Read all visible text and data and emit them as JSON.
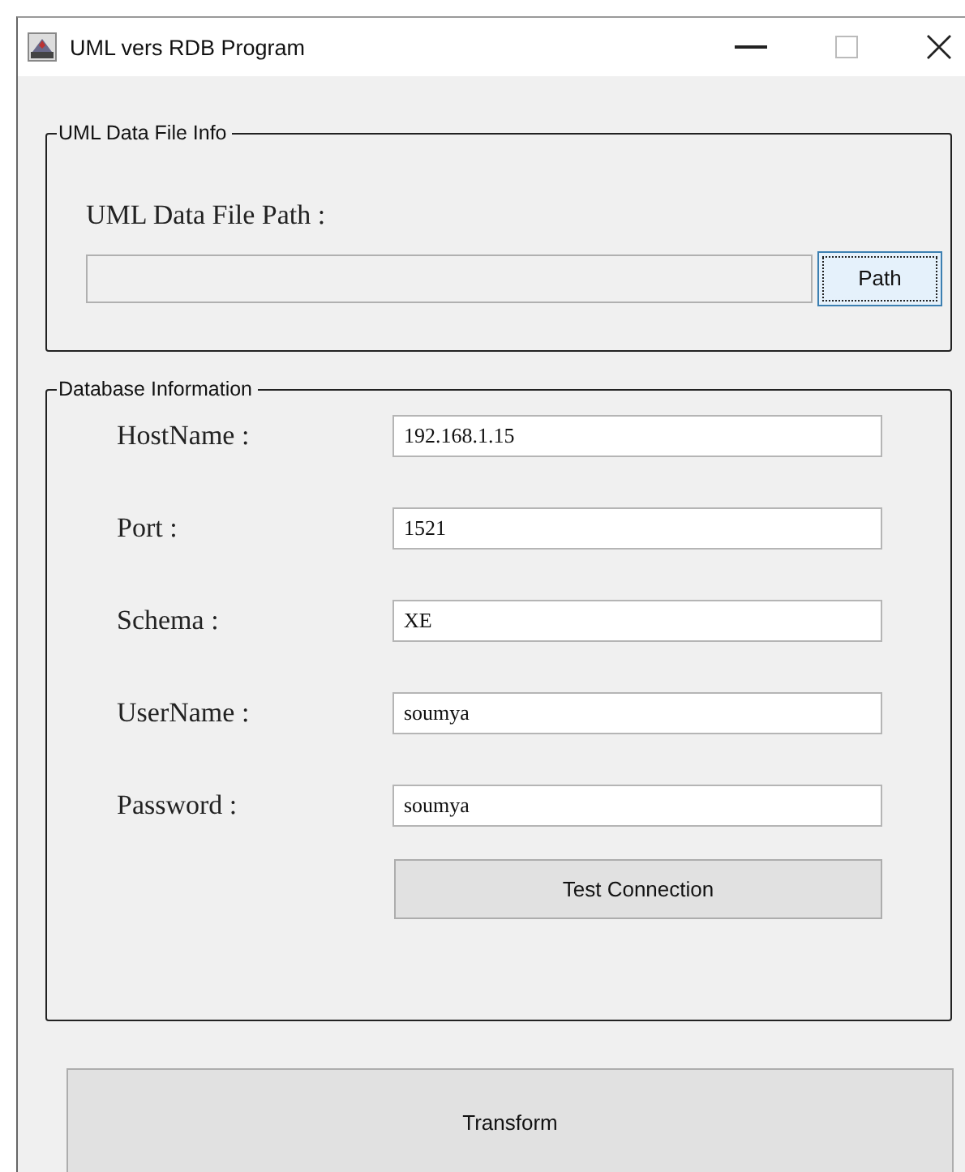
{
  "window": {
    "title": "UML vers RDB Program"
  },
  "file_info": {
    "legend": "UML Data File Info",
    "label": "UML Data File Path :",
    "path_button": {
      "label": "Path",
      "focused": true
    }
  },
  "database": {
    "legend": "Database Information",
    "fields": [
      {
        "label": "HostName :",
        "value": "192.168.1.15"
      },
      {
        "label": "Port :",
        "value": "1521"
      },
      {
        "label": "Schema :",
        "value": "XE"
      },
      {
        "label": "UserName :",
        "value": "soumya"
      },
      {
        "label": "Password :",
        "value": "soumya"
      }
    ],
    "test_button": "Test Connection"
  },
  "transform_button": "Transform"
}
